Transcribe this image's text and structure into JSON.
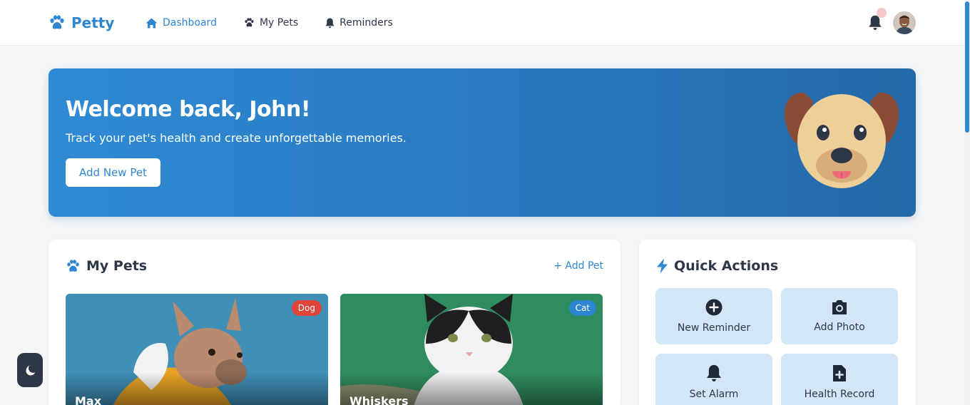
{
  "app": {
    "name": "Petty"
  },
  "nav": {
    "items": [
      {
        "label": "Dashboard",
        "icon": "home-icon",
        "active": true
      },
      {
        "label": "My Pets",
        "icon": "paw-icon",
        "active": false
      },
      {
        "label": "Reminders",
        "icon": "bell-icon",
        "active": false
      }
    ]
  },
  "hero": {
    "title": "Welcome back, John!",
    "subtitle": "Track your pet's health and create unforgettable memories.",
    "button_label": "Add New Pet"
  },
  "pets_section": {
    "title": "My Pets",
    "add_label": "+ Add Pet",
    "pets": [
      {
        "name": "Max",
        "type": "Dog",
        "badge_color": "#e0453a"
      },
      {
        "name": "Whiskers",
        "type": "Cat",
        "badge_color": "#2e86d1"
      }
    ]
  },
  "quick_actions": {
    "title": "Quick Actions",
    "items": [
      {
        "label": "New Reminder",
        "icon": "plus-circle-icon"
      },
      {
        "label": "Add Photo",
        "icon": "camera-icon"
      },
      {
        "label": "Set Alarm",
        "icon": "bell-icon"
      },
      {
        "label": "Health Record",
        "icon": "medical-file-icon"
      }
    ]
  },
  "colors": {
    "primary": "#2e86d1",
    "dark": "#2d3748",
    "tile": "#d3e6f5",
    "dog_badge": "#e0453a"
  }
}
